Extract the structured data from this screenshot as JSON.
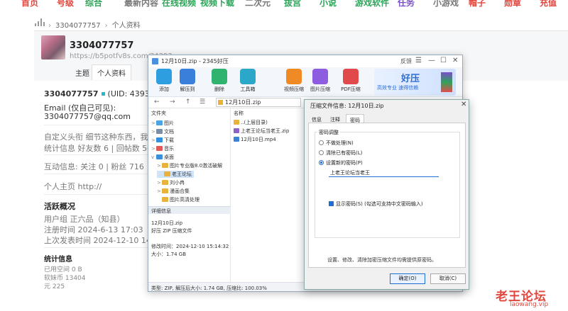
{
  "topnav": {
    "items": [
      "首页",
      "号级",
      "综合",
      "最新内容",
      "在线视频",
      "视频下载",
      "二次元",
      "拔宫",
      "小说",
      "游戏软件",
      "任务",
      "小游戏",
      "帽子",
      "勋章",
      "充值"
    ],
    "colors": [
      "#e0463d",
      "#e0463d",
      "#2fa35a",
      "#777777",
      "#2fa35a",
      "#2fa35a",
      "#777777",
      "#2fa35a",
      "#2fa35a",
      "#2fa35a",
      "#7b4dc9",
      "#777777",
      "#e0463d",
      "#e0463d",
      "#e0463d"
    ]
  },
  "breadcrumb": {
    "user": "3304077757",
    "page": "个人资料"
  },
  "profile": {
    "name": "3304077757",
    "url": "https://b5potfv8s.com/?4393",
    "tabs": [
      "主题",
      "个人资料"
    ],
    "uid_line_name": "3304077757",
    "uid": "(UID: 4393170)",
    "email_label": "Email (仅自己可见):",
    "email": "3304077757@qq.com",
    "signature": "自定义头衔  细节这种东西，我说的",
    "stats": "统计信息  好友数 6  |  回帖数 50  |",
    "interact": "互动信息:  关注 0  |  粉丝 716",
    "homepage": "个人主页  http://",
    "activity_title": "活跃概况",
    "usergroup": "用户组  正六品（知县）",
    "reg_time": "注册时间  2024-6-13 17:03",
    "last_post": "上次发表时间  2024-12-10 14:20",
    "stats_title": "统计信息",
    "used_space": "已用空间  0 B",
    "coins": "软妹币  13404",
    "yuan": "元  225"
  },
  "watermark": {
    "main": "老王论坛",
    "sub": "laowang.vip"
  },
  "zip_window": {
    "title": "12月10日.zip - 2345好压",
    "controls": [
      "反馈",
      "☰",
      "—",
      "☐",
      "✕"
    ],
    "toolbar": [
      {
        "label": "添加",
        "color": "#2d9ee0"
      },
      {
        "label": "解压到",
        "color": "#3a7fd9"
      },
      {
        "label": "删除",
        "color": "#2fb36e"
      },
      {
        "label": "工具箱",
        "color": "#2aa7c9"
      },
      {
        "label": "视频压缩",
        "color": "#f08a24"
      },
      {
        "label": "图片压缩",
        "color": "#8e5ce0"
      },
      {
        "label": "PDF压缩",
        "color": "#e04a4a"
      }
    ],
    "brand": {
      "name": "好压",
      "slogan": "高效专业  速得信赖"
    },
    "address": "12月10日.zip",
    "nav_buttons": [
      "←",
      "→",
      "↑",
      "☰"
    ],
    "folders_header": "文件夹",
    "folders": [
      {
        "label": "图片",
        "color": "#4ba3e3",
        "expander": ">"
      },
      {
        "label": "文档",
        "color": "#7c8ea4",
        "expander": ">"
      },
      {
        "label": "下载",
        "color": "#2f8fe0",
        "expander": ">"
      },
      {
        "label": "音乐",
        "color": "#e05a5a",
        "expander": ">"
      },
      {
        "label": "桌面",
        "color": "#3b8fdc",
        "expander": "v"
      },
      {
        "label": "图片专业版8.0激活破解",
        "color": "#e8b33a",
        "expander": ">"
      },
      {
        "label": "老王论坛",
        "color": "#e8b33a",
        "expander": ""
      },
      {
        "label": "刘小冉",
        "color": "#e8b33a",
        "expander": ">"
      },
      {
        "label": "漫画合集",
        "color": "#e8b33a",
        "expander": ">"
      },
      {
        "label": "图片高清处理",
        "color": "#e8b33a",
        "expander": ""
      }
    ],
    "details_header": "详细信息",
    "details": [
      "12月10日.zip",
      "好压 ZIP 压缩文件",
      "",
      "修改时间：2024-12-10 15:14:32",
      "大小：1.74 GB"
    ],
    "list_header": "名称",
    "files": [
      {
        "name": "..(上层目录)",
        "color": "#e8b33a"
      },
      {
        "name": "上老王论坛当老王.zip",
        "color": "#8a62c9"
      },
      {
        "name": "12月10日.mp4",
        "color": "#3b82d6"
      }
    ],
    "status": "类型: ZIP, 解压后大小: 1.74 GB, 压缩比: 100.03%"
  },
  "dialog": {
    "title": "压缩文件信息: 12月10日.zip",
    "close": "✕",
    "tabs": [
      "信息",
      "注释",
      "密码"
    ],
    "group_label": "密码调整",
    "radios": [
      "不做处理(N)",
      "清除已有密码(L)",
      "设置新的密码(P)"
    ],
    "password": "上老王论坛当老王",
    "show_password": "显示密码(S)    (勾选可支持中文密码输入)",
    "note": "设置、修改、清除加密压缩文件均需提供原密码。",
    "ok": "确定(O)",
    "cancel": "取消(C)"
  }
}
